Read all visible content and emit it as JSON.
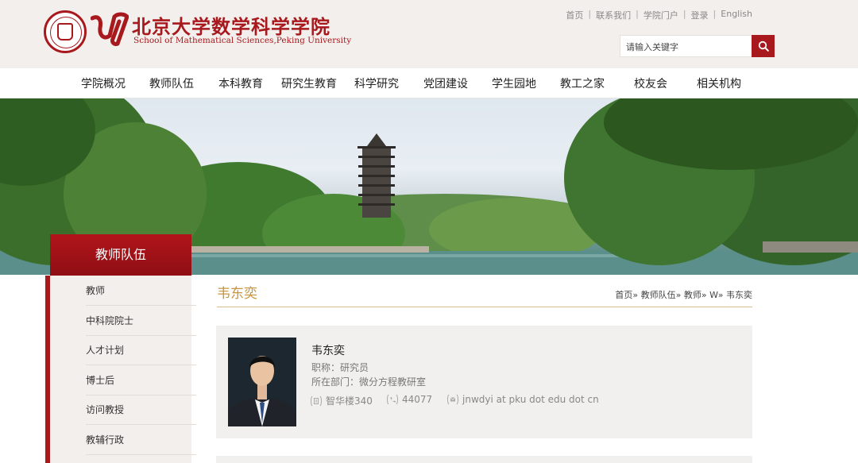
{
  "header": {
    "title_cn": "北京大学数学科学学院",
    "title_en": "School of Mathematical Sciences,Peking University",
    "top_links": [
      "首页",
      "联系我们",
      "学院门户",
      "登录",
      "English"
    ],
    "search_placeholder": "请输入关键字",
    "brand_color": "#a8191e"
  },
  "nav": {
    "items": [
      "学院概况",
      "教师队伍",
      "本科教育",
      "研究生教育",
      "科学研究",
      "党团建设",
      "学生园地",
      "教工之家",
      "校友会",
      "相关机构"
    ]
  },
  "sidebar": {
    "title": "教师队伍",
    "items": [
      "教师",
      "中科院院士",
      "人才计划",
      "博士后",
      "访问教授",
      "教辅行政"
    ]
  },
  "content": {
    "title": "韦东奕",
    "breadcrumb": "首页» 教师队伍» 教师» W» 韦东奕",
    "profile": {
      "name": "韦东奕",
      "title_label": "职称：",
      "title_value": "研究员",
      "dept_label": "所在部门：",
      "dept_value": "微分方程教研室",
      "office": "智华楼340",
      "phone": "44077",
      "email": "jnwdyi at pku dot edu dot cn"
    }
  },
  "icons": {
    "search": "search-icon",
    "office": "building-icon",
    "phone": "phone-icon",
    "email": "email-icon"
  }
}
